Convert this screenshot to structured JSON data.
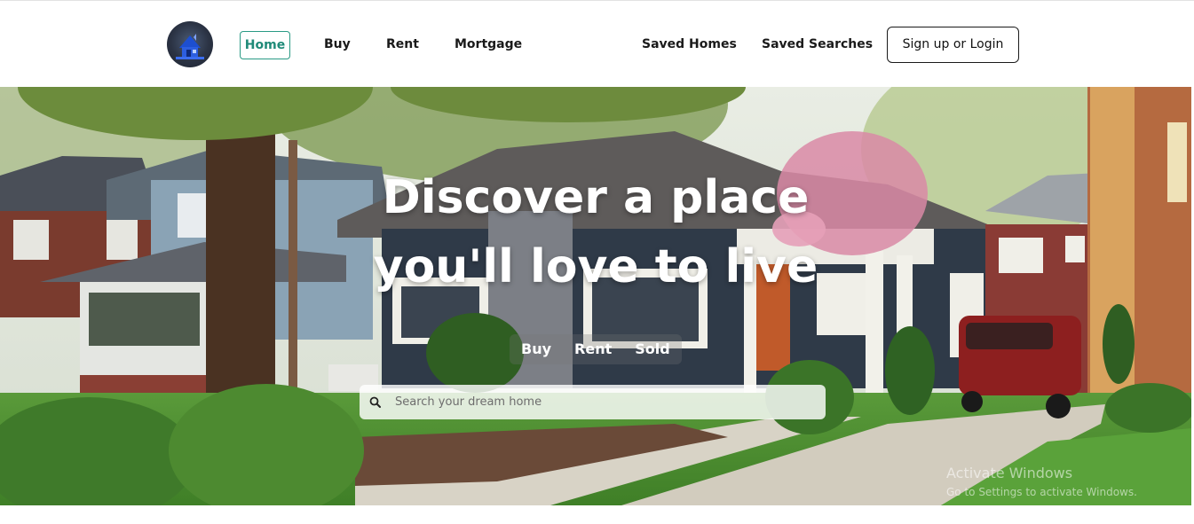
{
  "nav": {
    "logo_icon": "house-logo-icon",
    "links": [
      "Home",
      "Buy",
      "Rent",
      "Mortgage"
    ],
    "active": "Home",
    "saved_homes": "Saved Homes",
    "saved_searches": "Saved Searches",
    "login_label": "Sign up or Login"
  },
  "hero": {
    "title_line1": "Discover a place",
    "title_line2": "you'll love to live",
    "tabs": [
      "Buy",
      "Rent",
      "Sold"
    ],
    "search": {
      "placeholder": "Search your dream home",
      "icon": "search-icon"
    }
  },
  "watermark": {
    "title": "Activate Windows",
    "subtitle": "Go to Settings to activate Windows."
  },
  "colors": {
    "accent": "#1f8a78",
    "hero_text": "#ffffff"
  }
}
